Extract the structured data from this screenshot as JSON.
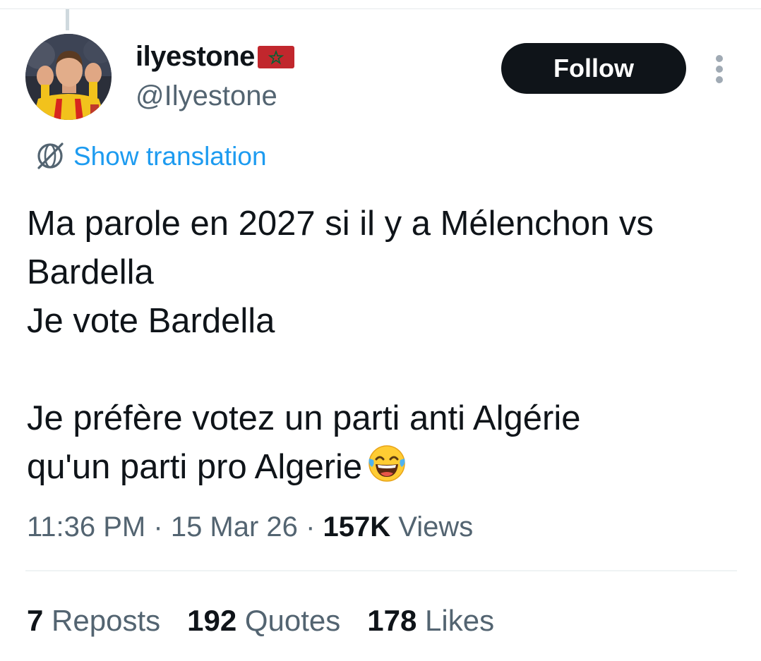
{
  "author": {
    "display_name": "ilyestone",
    "flag": "Morocco flag",
    "handle": "@Ilyestone"
  },
  "actions": {
    "follow_label": "Follow",
    "more_icon": "more-vertical-icon"
  },
  "translation": {
    "icon": "translate-globe-icon",
    "label": "Show translation"
  },
  "tweet": {
    "lines": [
      "Ma parole en 2027 si il y a Mélenchon vs",
      "Bardella",
      "Je vote Bardella",
      "",
      "Je préfère votez un parti anti Algérie",
      "qu'un parti pro Algerie"
    ],
    "emoji": "face-with-tears-of-joy"
  },
  "meta": {
    "time": "11:36 PM",
    "separator": "·",
    "date": "15 Mar 26",
    "views_count": "157K",
    "views_label": "Views"
  },
  "stats": [
    {
      "count": "7",
      "label": "Reposts"
    },
    {
      "count": "192",
      "label": "Quotes"
    },
    {
      "count": "178",
      "label": "Likes"
    }
  ],
  "colors": {
    "text": "#0f1419",
    "secondary": "#536471",
    "link": "#1d9bf0",
    "button": "#0f1419"
  }
}
